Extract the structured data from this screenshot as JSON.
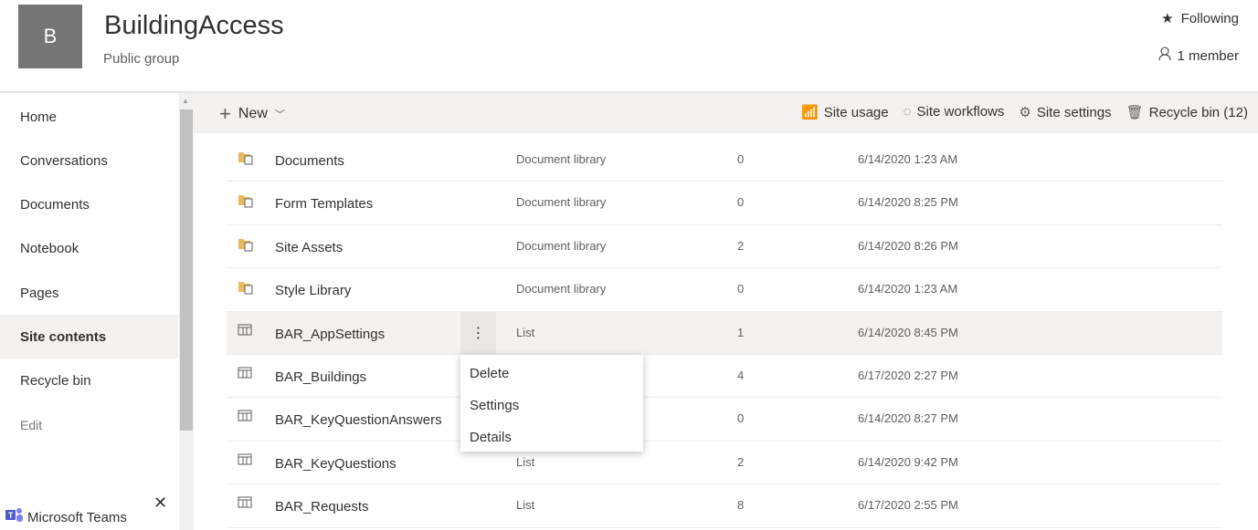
{
  "site": {
    "logo_letter": "B",
    "title": "BuildingAccess",
    "subtitle": "Public group",
    "following": "Following",
    "members": "1 member"
  },
  "nav": {
    "items": [
      {
        "label": "Home"
      },
      {
        "label": "Conversations"
      },
      {
        "label": "Documents"
      },
      {
        "label": "Notebook"
      },
      {
        "label": "Pages"
      },
      {
        "label": "Site contents",
        "active": true
      },
      {
        "label": "Recycle bin"
      }
    ],
    "edit": "Edit"
  },
  "teams": {
    "label": "Microsoft Teams"
  },
  "command_bar": {
    "new": "New",
    "site_usage": "Site usage",
    "site_workflows": "Site workflows",
    "site_settings": "Site settings",
    "recycle_bin": "Recycle bin (12)"
  },
  "contents": [
    {
      "icon": "library",
      "name": "Documents",
      "type": "Document library",
      "count": "0",
      "modified": "6/14/2020 1:23 AM"
    },
    {
      "icon": "library",
      "name": "Form Templates",
      "type": "Document library",
      "count": "0",
      "modified": "6/14/2020 8:25 PM"
    },
    {
      "icon": "library",
      "name": "Site Assets",
      "type": "Document library",
      "count": "2",
      "modified": "6/14/2020 8:26 PM"
    },
    {
      "icon": "library",
      "name": "Style Library",
      "type": "Document library",
      "count": "0",
      "modified": "6/14/2020 1:23 AM"
    },
    {
      "icon": "list",
      "name": "BAR_AppSettings",
      "type": "List",
      "count": "1",
      "modified": "6/14/2020 8:45 PM",
      "selected": true
    },
    {
      "icon": "list",
      "name": "BAR_Buildings",
      "type": "",
      "count": "4",
      "modified": "6/17/2020 2:27 PM"
    },
    {
      "icon": "list",
      "name": "BAR_KeyQuestionAnswers",
      "type": "",
      "count": "0",
      "modified": "6/14/2020 8:27 PM"
    },
    {
      "icon": "list",
      "name": "BAR_KeyQuestions",
      "type": "List",
      "count": "2",
      "modified": "6/14/2020 9:42 PM"
    },
    {
      "icon": "list",
      "name": "BAR_Requests",
      "type": "List",
      "count": "8",
      "modified": "6/17/2020 2:55 PM"
    }
  ],
  "context_menu": {
    "items": [
      "Delete",
      "Settings",
      "Details"
    ]
  },
  "colors": {
    "library_icon": "#e8b85a",
    "selected_row": "#f3f2f1",
    "command_bar": "#f3f2f1",
    "logo": "#757575"
  }
}
